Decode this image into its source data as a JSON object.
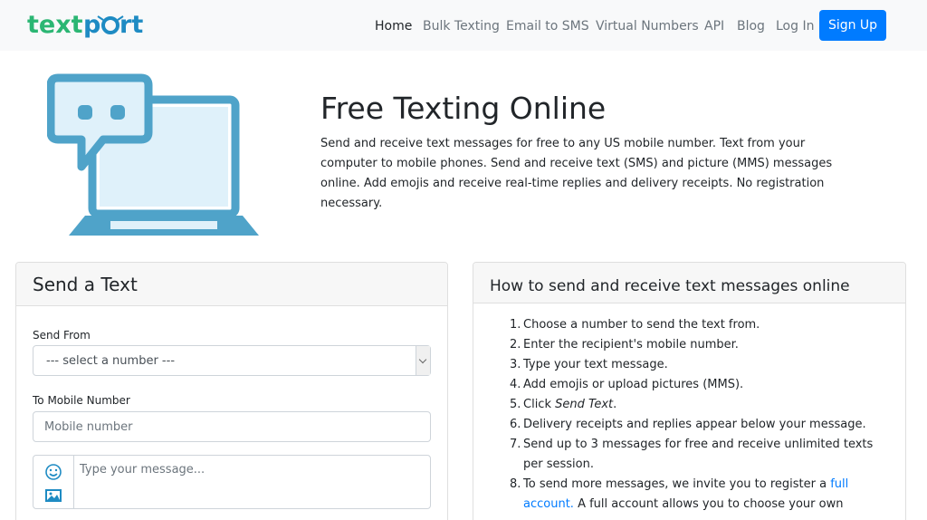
{
  "nav": {
    "links": [
      "Home",
      "Bulk Texting",
      "Email to SMS",
      "Virtual Numbers",
      "API",
      "Blog",
      "Log In"
    ],
    "signup": "Sign Up"
  },
  "hero": {
    "title": "Free Texting Online",
    "description": "Send and receive text messages for free to any US mobile number. Text from your computer to mobile phones. Send and receive text (SMS) and picture (MMS) messages online. Add emojis and receive real-time replies and delivery receipts. No registration necessary."
  },
  "send_card": {
    "title": "Send a Text",
    "from_label": "Send From",
    "from_value": "--- select a number ---",
    "to_label": "To Mobile Number",
    "to_placeholder": "Mobile number",
    "message_placeholder": "Type your message..."
  },
  "how_card": {
    "title": "How to send and receive text messages online",
    "steps": [
      {
        "num": "1.",
        "text": "Choose a number to send the text from."
      },
      {
        "num": "2.",
        "text": "Enter the recipient's mobile number."
      },
      {
        "num": "3.",
        "text": "Type your text message."
      },
      {
        "num": "4.",
        "text": "Add emojis or upload pictures (MMS)."
      },
      {
        "num": "5.",
        "pre": "Click ",
        "em": "Send Text",
        "post": "."
      },
      {
        "num": "6.",
        "text": "Delivery receipts and replies appear below your message."
      },
      {
        "num": "7.",
        "text": "Send up to 3 messages for free and receive unlimited texts per session."
      },
      {
        "num": "8.",
        "pre": "To send more messages, we invite you to register a ",
        "link": "full account.",
        "post": " A full account allows you to choose your own"
      }
    ]
  },
  "colors": {
    "brand_green": "#2bb673",
    "brand_blue": "#1e8bc3",
    "accent": "#007bff",
    "illustration": "#4fa3c9"
  }
}
